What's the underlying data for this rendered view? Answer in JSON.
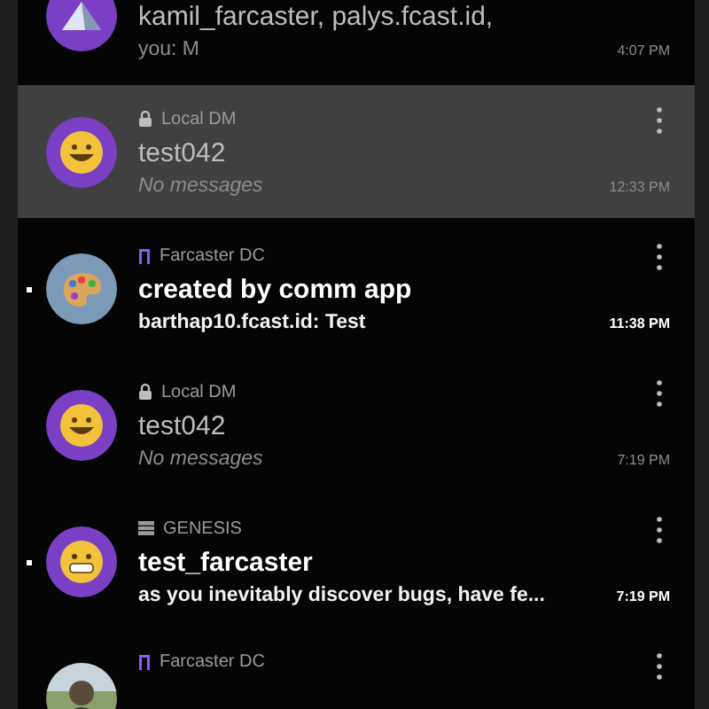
{
  "threads": [
    {
      "label": {
        "kind": "none"
      },
      "avatar": {
        "kind": "mountain"
      },
      "title": "kamil_farcaster, palys.fcast.id,",
      "subtitle": "you: M",
      "subtitle_italic": false,
      "time": "4:07 PM",
      "unread": false,
      "selected": false
    },
    {
      "label": {
        "kind": "lock",
        "text": "Local DM"
      },
      "avatar": {
        "kind": "smiley"
      },
      "title": "test042",
      "subtitle": "No messages",
      "subtitle_italic": true,
      "time": "12:33 PM",
      "unread": false,
      "selected": true
    },
    {
      "label": {
        "kind": "farcaster",
        "text": "Farcaster DC"
      },
      "avatar": {
        "kind": "palette"
      },
      "title": "created by comm app",
      "subtitle": "barthap10.fcast.id: Test",
      "subtitle_italic": false,
      "time": "11:38 PM",
      "unread": true,
      "selected": false
    },
    {
      "label": {
        "kind": "lock",
        "text": "Local DM"
      },
      "avatar": {
        "kind": "smiley"
      },
      "title": "test042",
      "subtitle": "No messages",
      "subtitle_italic": true,
      "time": "7:19 PM",
      "unread": false,
      "selected": false
    },
    {
      "label": {
        "kind": "genesis",
        "text": "GENESIS"
      },
      "avatar": {
        "kind": "grin"
      },
      "title": "test_farcaster",
      "subtitle": "as you inevitably discover bugs, have fe...",
      "subtitle_italic": false,
      "time": "7:19 PM",
      "unread": true,
      "selected": false
    },
    {
      "label": {
        "kind": "farcaster",
        "text": "Farcaster DC"
      },
      "unread": false,
      "selected": false
    }
  ]
}
